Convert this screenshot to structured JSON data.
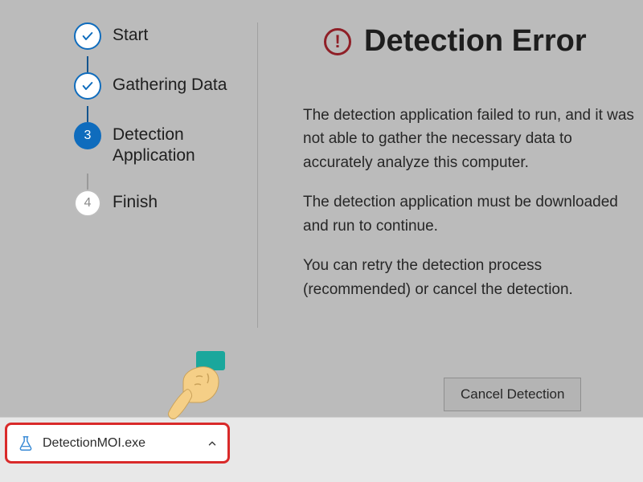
{
  "stepper": {
    "steps": [
      {
        "label": "Start",
        "state": "done"
      },
      {
        "label": "Gathering Data",
        "state": "done"
      },
      {
        "label": "Detection Application",
        "state": "active",
        "num": "3"
      },
      {
        "label": "Finish",
        "state": "pending",
        "num": "4"
      }
    ]
  },
  "heading": {
    "title": "Detection Error"
  },
  "body": {
    "p1": "The detection application failed to run, and it was not able to gather the necessary data to accurately analyze this computer.",
    "p2": "The detection application must be downloaded and run to continue.",
    "p3": "You can retry the detection process (recommended) or cancel the detection."
  },
  "buttons": {
    "cancel": "Cancel Detection"
  },
  "download": {
    "filename": "DetectionMOI.exe"
  },
  "icons": {
    "error": "error-circle-icon",
    "check": "check-icon",
    "file": "flask-file-icon",
    "chevron": "chevron-up-icon",
    "hand": "pointing-hand-icon"
  }
}
